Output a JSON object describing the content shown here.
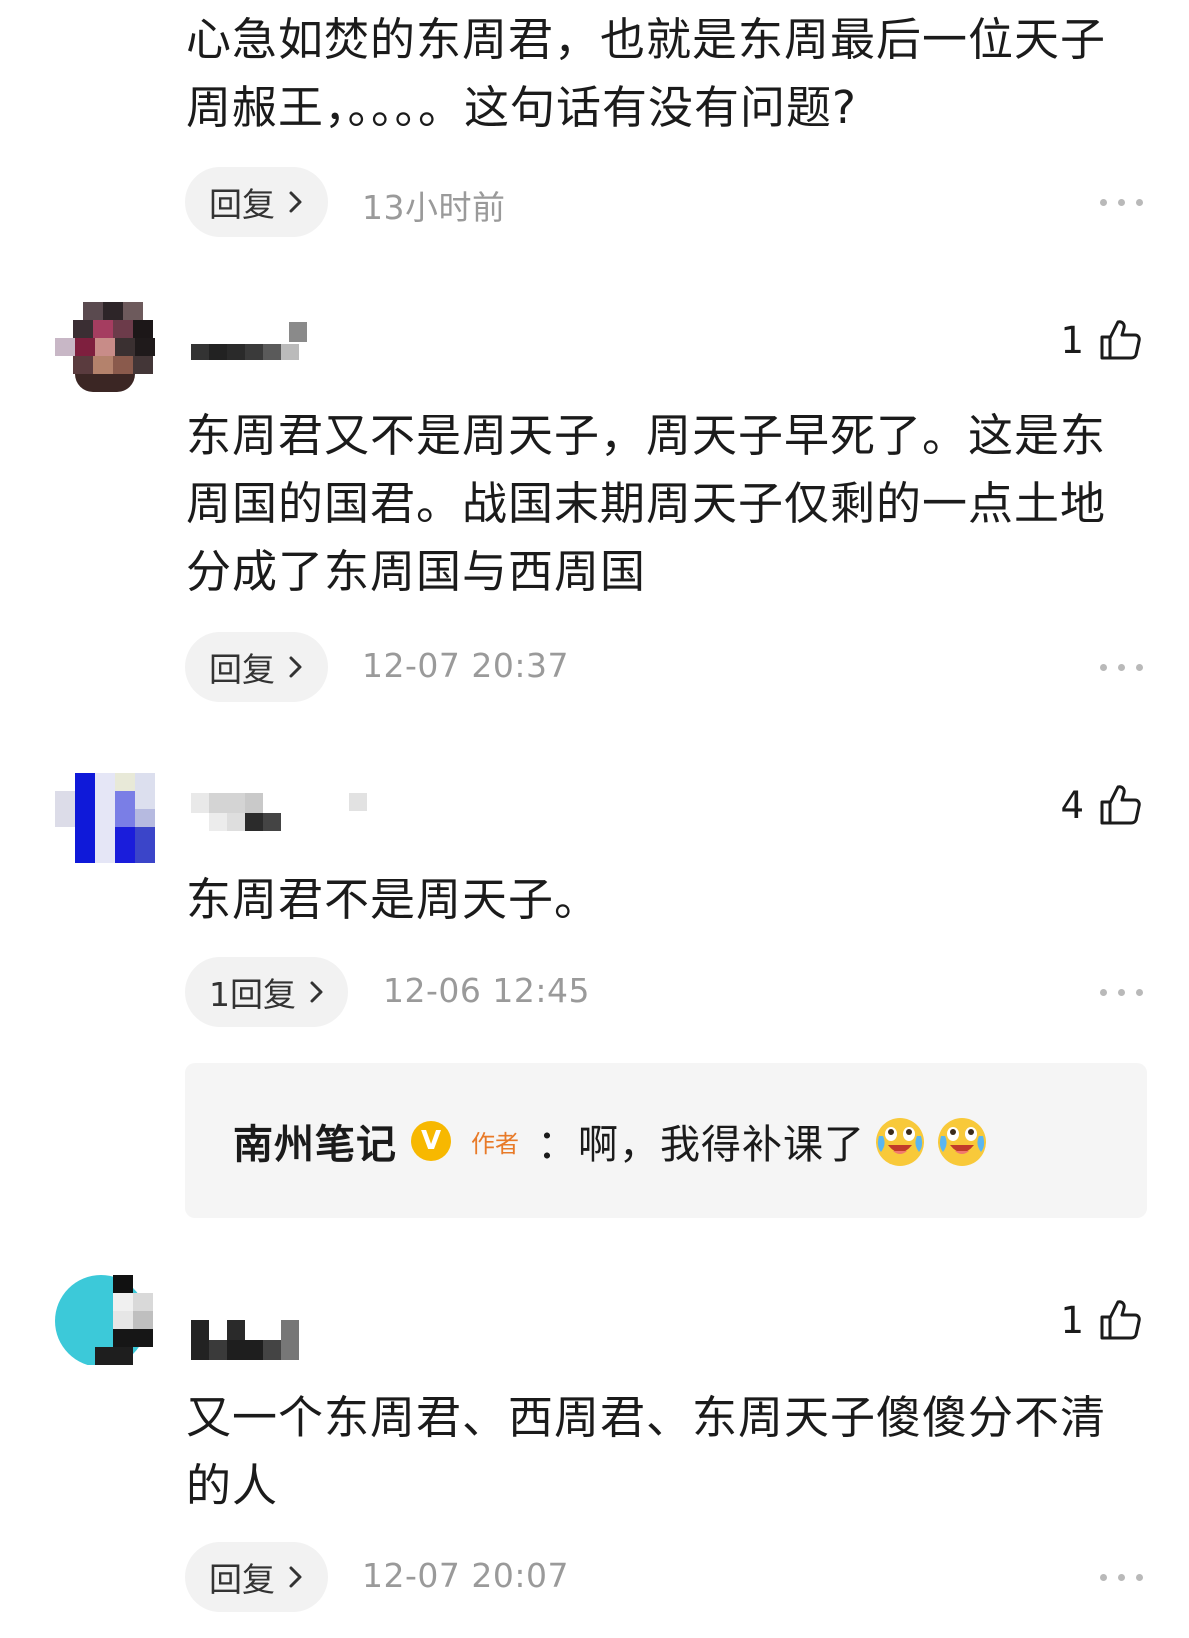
{
  "comments": [
    {
      "text": "心急如焚的东周君，也就是东周最后一位天子周赧王，。。。。这句话有没有问题?",
      "reply_label": "回复",
      "time": "13小时前"
    },
    {
      "likes": "1",
      "text": "东周君又不是周天子，周天子早死了。这是东周国的国君。战国末期周天子仅剩的一点土地分成了东周国与西周国",
      "reply_label": "回复",
      "time": "12-07 20:37"
    },
    {
      "likes": "4",
      "text": "东周君不是周天子。",
      "reply_label": "1回复",
      "time": "12-06 12:45",
      "author_reply": {
        "name": "南州笔记",
        "badge": "V",
        "tag": "作者",
        "text": "：啊，我得补课了",
        "emoji": "crying-laughing-emoji"
      }
    },
    {
      "likes": "1",
      "text": "又一个东周君、西周君、东周天子傻傻分不清的人",
      "reply_label": "回复",
      "time": "12-07 20:07"
    }
  ],
  "icons": {
    "like": "thumbs-up-icon",
    "more": "more-dots-icon",
    "reply_arrow": "chevron-right-icon"
  },
  "colors": {
    "time": "#9a9a9a",
    "pill_bg": "#f2f2f2",
    "author_tag": "#e87a28",
    "verified_badge": "#f7b800"
  }
}
